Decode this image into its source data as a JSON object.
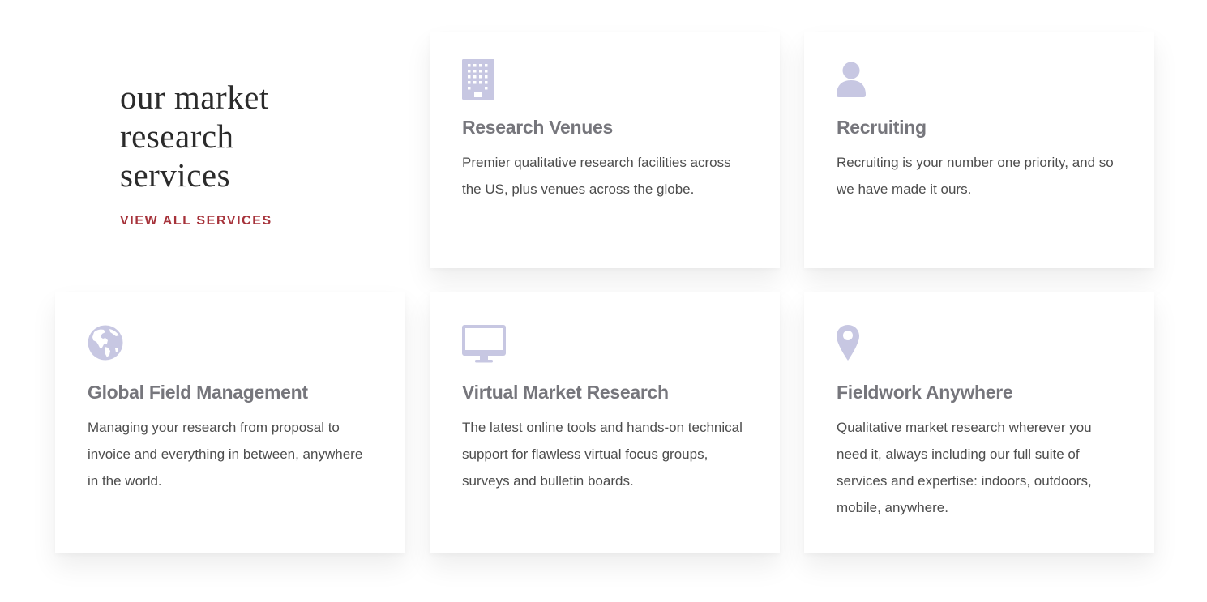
{
  "intro": {
    "title_lines": [
      "our market",
      "research",
      "services"
    ],
    "link_label": "VIEW ALL SERVICES"
  },
  "colors": {
    "icon": "#c7c7e2",
    "accent": "#a6323a",
    "title": "#76767c",
    "text": "#4d4d4d"
  },
  "services": [
    {
      "icon": "building-icon",
      "title": "Research Venues",
      "description": "Premier qualitative research facilities across the US, plus venues across the globe."
    },
    {
      "icon": "person-icon",
      "title": "Recruiting",
      "description": "Recruiting is your number one priority, and so we have made it ours."
    },
    {
      "icon": "globe-icon",
      "title": "Global Field Management",
      "description": "Managing your research from proposal to invoice and everything in between, anywhere in the world."
    },
    {
      "icon": "monitor-icon",
      "title": "Virtual Market Research",
      "description": "The latest online tools and hands-on technical support for flawless virtual focus groups, surveys and bulletin boards."
    },
    {
      "icon": "map-pin-icon",
      "title": "Fieldwork Anywhere",
      "description": "Qualitative market research wherever you need it, always including our full suite of services and expertise: indoors, outdoors, mobile, anywhere."
    }
  ]
}
